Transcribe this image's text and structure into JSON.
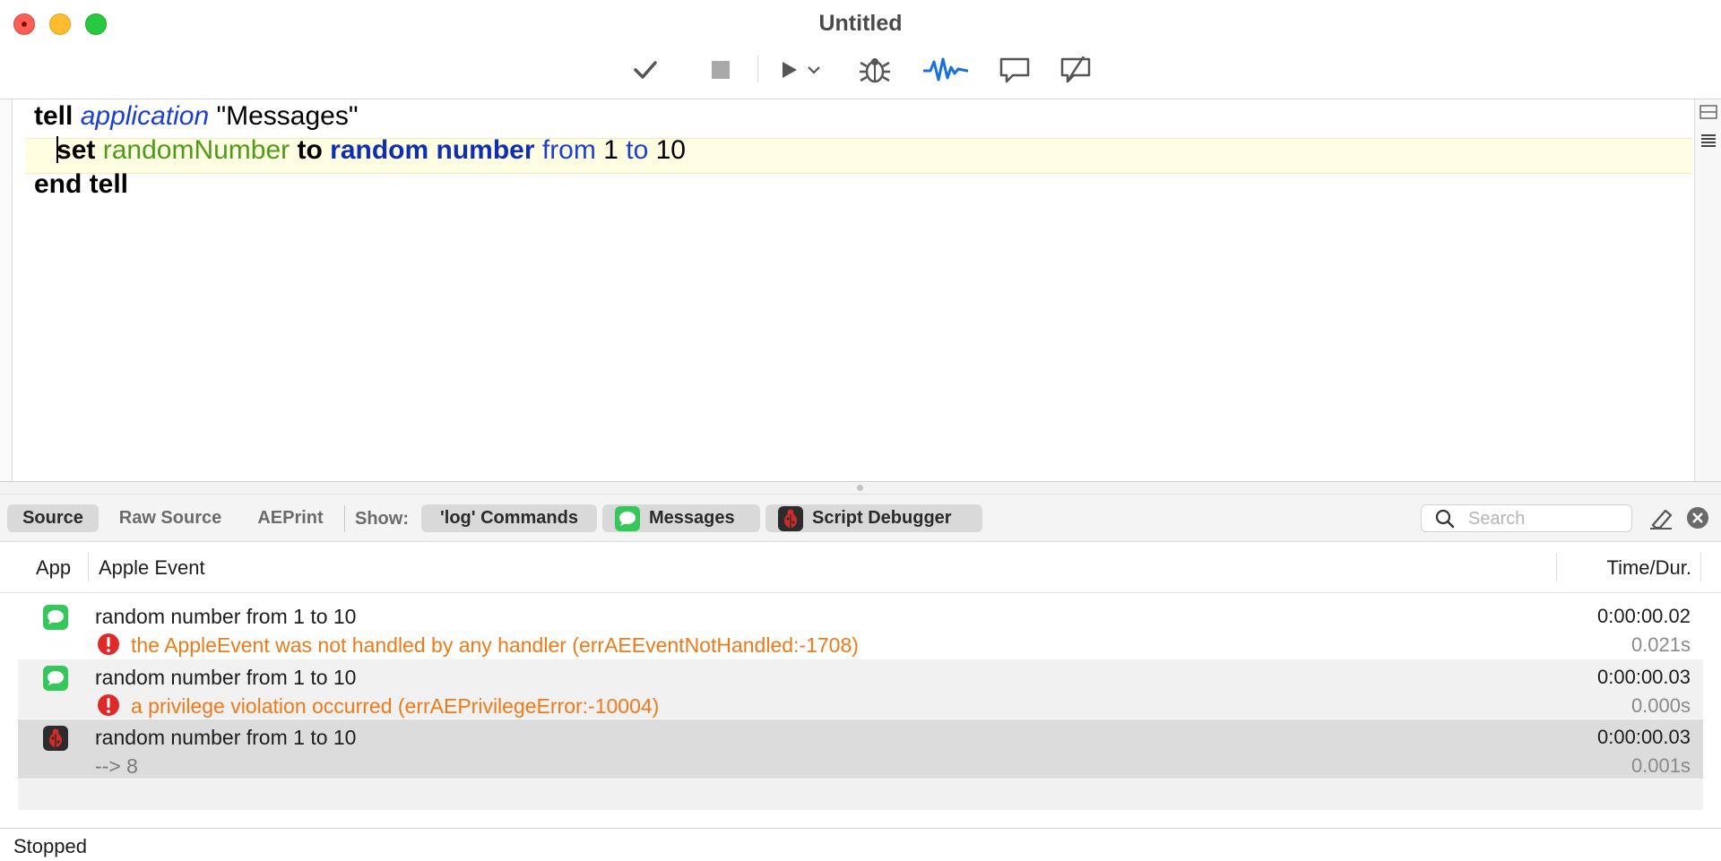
{
  "window": {
    "title": "Untitled"
  },
  "toolbar": {
    "compile": "checkmark-icon",
    "stop": "stop-icon",
    "run": "play-icon",
    "debugger": "bug-icon",
    "log": "waveform-icon",
    "comment": "comment-icon",
    "uncomment": "uncomment-icon"
  },
  "code": {
    "line1": {
      "kw": "tell",
      "cls": "application",
      "str": "\"Messages\""
    },
    "line2": {
      "kw1": "set",
      "var": "randomNumber",
      "kw2": "to",
      "cmd": "random number",
      "p1": "from",
      "n1": "1",
      "p2": "to",
      "n2": "10"
    },
    "line3": {
      "kw": "end tell"
    }
  },
  "log_toolbar": {
    "source": "Source",
    "raw_source": "Raw Source",
    "aeprint": "AEPrint",
    "show_label": "Show:",
    "log_commands": "'log' Commands",
    "messages": "Messages",
    "script_debugger": "Script Debugger",
    "search_placeholder": "Search"
  },
  "table": {
    "headers": {
      "app": "App",
      "event": "Apple Event",
      "time": "Time/Dur."
    },
    "rows": [
      {
        "event": "random number from 1 to 10",
        "error": "the AppleEvent was not handled by any handler (errAEEventNotHandled:-1708)",
        "time": "0:00:00.02",
        "dur": "0.021s"
      },
      {
        "event": "random number from 1 to 10",
        "error": "a privilege violation occurred (errAEPrivilegeError:-10004)",
        "time": "0:00:00.03",
        "dur": "0.000s"
      },
      {
        "event": "random number from 1 to 10",
        "result": "--> 8",
        "time": "0:00:00.03",
        "dur": "0.001s"
      }
    ]
  },
  "status": {
    "text": "Stopped"
  },
  "colors": {
    "error": "#ee7a1a",
    "keyword_blue": "#0e2fb3",
    "variable_green": "#4c9b19",
    "accent": "#1a6fe0"
  }
}
